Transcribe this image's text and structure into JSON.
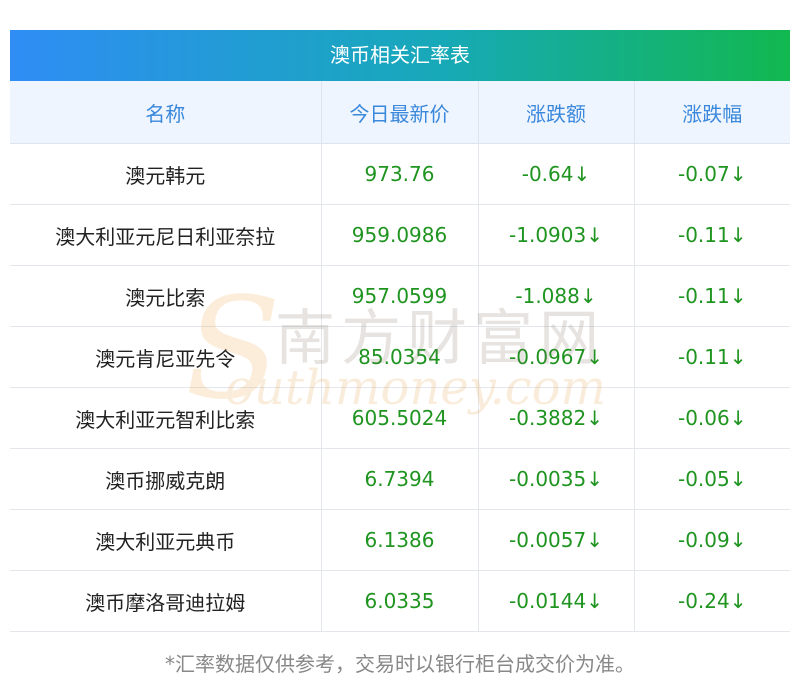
{
  "title": "澳币相关汇率表",
  "headers": [
    "名称",
    "今日最新价",
    "涨跌额",
    "涨跌幅"
  ],
  "rows": [
    {
      "name": "澳元韩元",
      "price": "973.76",
      "change": "-0.64↓",
      "percent": "-0.07↓"
    },
    {
      "name": "澳大利亚元尼日利亚奈拉",
      "price": "959.0986",
      "change": "-1.0903↓",
      "percent": "-0.11↓"
    },
    {
      "name": "澳元比索",
      "price": "957.0599",
      "change": "-1.088↓",
      "percent": "-0.11↓"
    },
    {
      "name": "澳元肯尼亚先令",
      "price": "85.0354",
      "change": "-0.0967↓",
      "percent": "-0.11↓"
    },
    {
      "name": "澳大利亚元智利比索",
      "price": "605.5024",
      "change": "-0.3882↓",
      "percent": "-0.06↓"
    },
    {
      "name": "澳币挪威克朗",
      "price": "6.7394",
      "change": "-0.0035↓",
      "percent": "-0.05↓"
    },
    {
      "name": "澳大利亚元典币",
      "price": "6.1386",
      "change": "-0.0057↓",
      "percent": "-0.09↓"
    },
    {
      "name": "澳币摩洛哥迪拉姆",
      "price": "6.0335",
      "change": "-0.0144↓",
      "percent": "-0.24↓"
    }
  ],
  "watermark": {
    "cn": "南方财富网",
    "en": "outhmoney.com",
    "letter": "S"
  },
  "footnote": "*汇率数据仅供参考，交易时以银行柜台成交价为准。",
  "colors": {
    "header_text": "#3a88dc",
    "value_text": "#1f9420",
    "title_gradient_start": "#2f8df5",
    "title_gradient_end": "#12b84f"
  }
}
